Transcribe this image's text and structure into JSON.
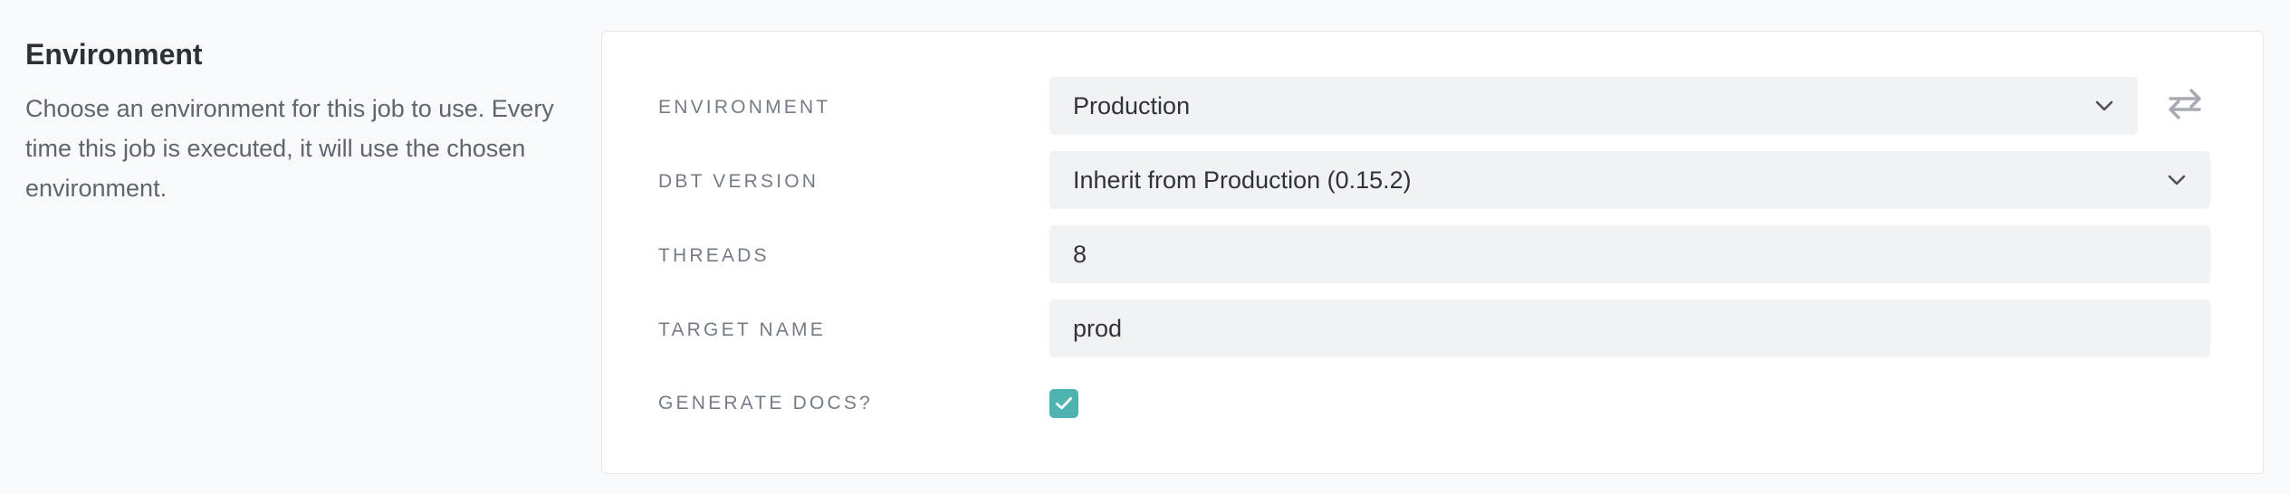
{
  "section": {
    "title": "Environment",
    "description": "Choose an environment for this job to use. Every time this job is executed, it will use the chosen environment."
  },
  "form": {
    "environment": {
      "label": "ENVIRONMENT",
      "value": "Production",
      "icon": "chevron-down-icon",
      "swap_icon": "swap-arrows-icon"
    },
    "dbt_version": {
      "label": "DBT VERSION",
      "value": "Inherit from Production (0.15.2)",
      "icon": "chevron-down-icon"
    },
    "threads": {
      "label": "THREADS",
      "value": "8"
    },
    "target_name": {
      "label": "TARGET NAME",
      "value": "prod"
    },
    "generate_docs": {
      "label": "GENERATE DOCS?",
      "checked": true,
      "icon": "checkmark-icon"
    }
  },
  "colors": {
    "accent": "#4fb3b2",
    "field_bg": "#f1f2f3",
    "page_bg": "#f8f9fb"
  }
}
